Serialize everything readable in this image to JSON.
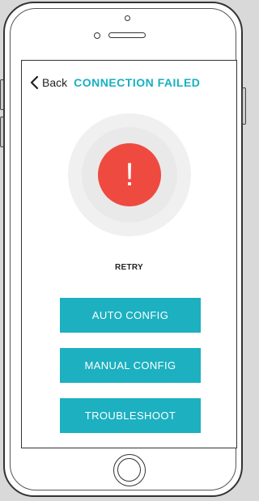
{
  "header": {
    "back_label": "Back",
    "title": "CONNECTION FAILED"
  },
  "status": {
    "icon": "alert-exclamation",
    "symbol": "!",
    "color": "#ef4a3f"
  },
  "retry_label": "RETRY",
  "buttons": [
    {
      "label": "AUTO CONFIG"
    },
    {
      "label": "MANUAL CONFIG"
    },
    {
      "label": "TROUBLESHOOT"
    }
  ],
  "colors": {
    "accent": "#1cb0c0",
    "alert": "#ef4a3f"
  }
}
